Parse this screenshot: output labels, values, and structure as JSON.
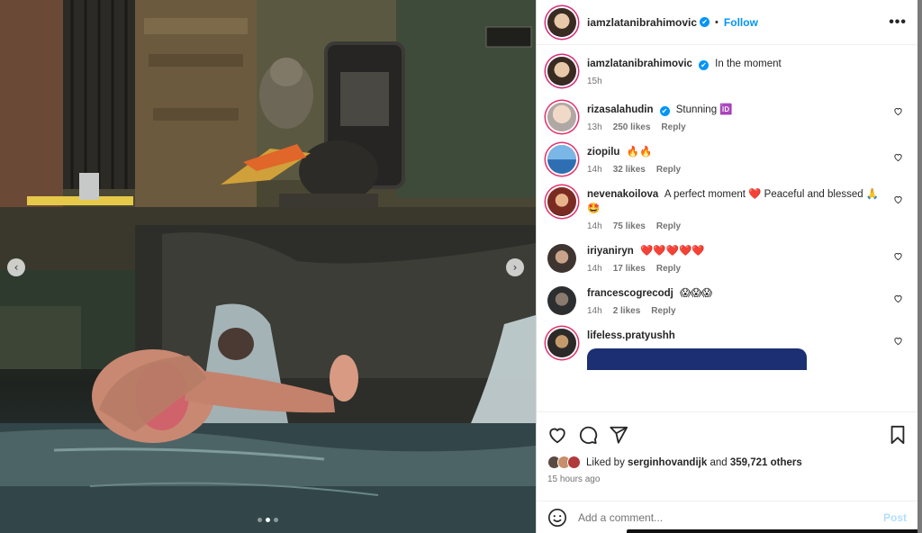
{
  "post": {
    "author": "iamzlatanibrahimovic",
    "follow_label": "Follow",
    "separator": "•",
    "more_label": "•••",
    "caption": "In the moment",
    "caption_time": "15h"
  },
  "comments": [
    {
      "user": "rizasalahudin",
      "verified": true,
      "text": "Stunning 🆔",
      "time": "13h",
      "likes": "250 likes",
      "reply": "Reply"
    },
    {
      "user": "ziopilu",
      "verified": false,
      "text": "🔥🔥",
      "time": "14h",
      "likes": "32 likes",
      "reply": "Reply"
    },
    {
      "user": "nevenakoilova",
      "verified": false,
      "text": "A perfect moment ❤️ Peaceful and blessed 🙏🤩",
      "time": "14h",
      "likes": "75 likes",
      "reply": "Reply"
    },
    {
      "user": "iriyaniryn",
      "verified": false,
      "text": "❤️❤️❤️❤️❤️",
      "time": "14h",
      "likes": "17 likes",
      "reply": "Reply"
    },
    {
      "user": "francescogrecodj",
      "verified": false,
      "text": "😱😱😱",
      "time": "14h",
      "likes": "2 likes",
      "reply": "Reply"
    },
    {
      "user": "lifeless.pratyushh",
      "verified": false,
      "text": "",
      "time": "",
      "likes": "",
      "reply": ""
    }
  ],
  "likes": {
    "prefix": "Liked by",
    "user": "serginhovandijk",
    "middle": "and",
    "count": "359,721 others",
    "ago": "15 hours ago"
  },
  "comment_box": {
    "placeholder": "Add a comment...",
    "post_label": "Post"
  },
  "icons": {
    "verified": "✔",
    "emoji": "emoji-icon",
    "like": "heart-icon",
    "comment": "comment-icon",
    "share": "send-icon",
    "save": "bookmark-icon",
    "prev": "‹",
    "next": "›"
  },
  "colors": {
    "link_blue": "#0095f6",
    "story_ring": "#e1306c",
    "muted": "#737373",
    "post_disabled": "#b2dffc"
  }
}
